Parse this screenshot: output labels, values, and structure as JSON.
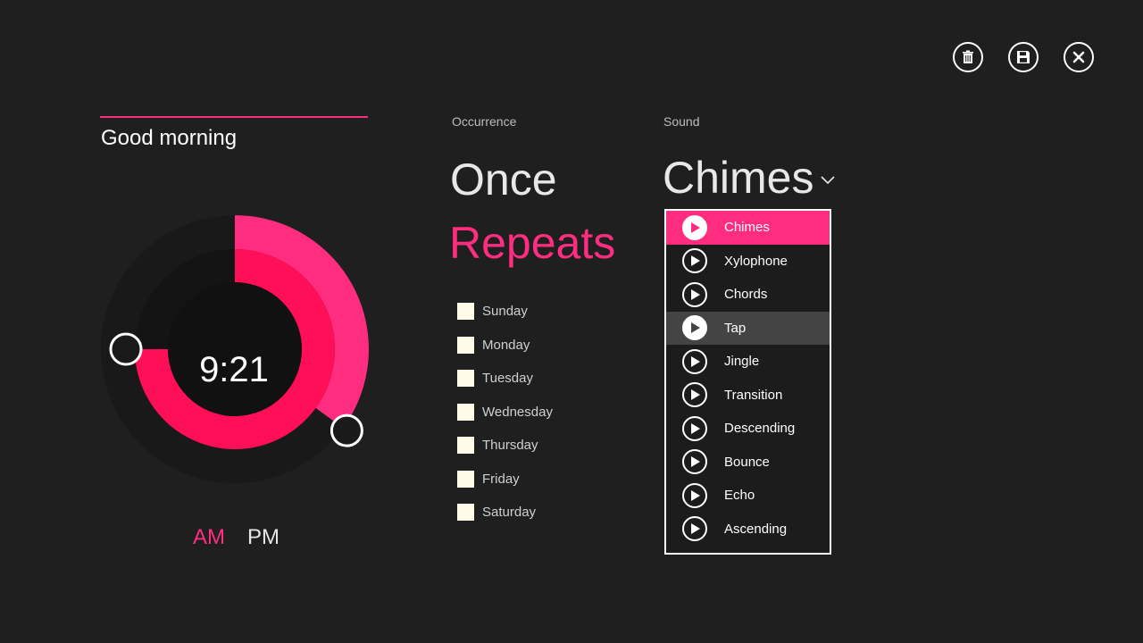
{
  "alarm": {
    "name": "Good morning",
    "time": "9:21",
    "hour": 9,
    "minute": 21,
    "am_label": "AM",
    "pm_label": "PM",
    "period": "AM"
  },
  "toolbar": {
    "delete_icon": "trash-icon",
    "save_icon": "save-icon",
    "close_icon": "close-icon"
  },
  "occurrence": {
    "label": "Occurrence",
    "options": [
      "Once",
      "Repeats"
    ],
    "selected": "Repeats",
    "days": [
      "Sunday",
      "Monday",
      "Tuesday",
      "Wednesday",
      "Thursday",
      "Friday",
      "Saturday"
    ]
  },
  "sound": {
    "label": "Sound",
    "selected": "Chimes",
    "hovered": "Tap",
    "options": [
      "Chimes",
      "Xylophone",
      "Chords",
      "Tap",
      "Jingle",
      "Transition",
      "Descending",
      "Bounce",
      "Echo",
      "Ascending"
    ]
  },
  "colors": {
    "accent": "#ff2d7f",
    "hour_arc": "#ff0f57",
    "background": "#1f1f1f"
  }
}
